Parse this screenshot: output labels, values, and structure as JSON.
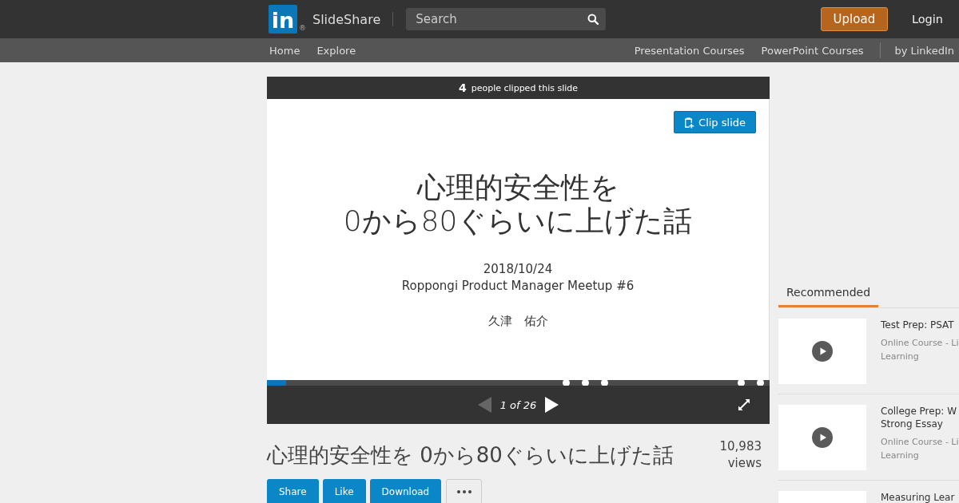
{
  "header": {
    "logo": {
      "mark": "in",
      "registered": "®",
      "name": "SlideShare"
    },
    "search": {
      "placeholder": "Search"
    },
    "upload_button": "Upload",
    "login": "Login"
  },
  "subnav": {
    "left": [
      "Home",
      "Explore"
    ],
    "right": [
      "Presentation Courses",
      "PowerPoint Courses"
    ],
    "brand": "by LinkedIn"
  },
  "player": {
    "clip_count": "4",
    "clip_text": "people clipped this slide",
    "clip_button": "Clip slide",
    "slide": {
      "title_lines": [
        "心理的安全性を",
        "0から80ぐらいに上げた話"
      ],
      "date": "2018/10/24",
      "event": "Roppongi Product Manager Meetup #6",
      "author": "久津　佑介"
    },
    "progress": {
      "level": 0.038
    },
    "prev": {
      "disabled": true
    },
    "next": {
      "disabled": false
    },
    "page": "1 of 26"
  },
  "presentation": {
    "title": "心理的安全性を 0から80ぐらいに上げた話",
    "views": "10,983",
    "views_label": "views",
    "actions": [
      "Share",
      "Like",
      "Download"
    ]
  },
  "sidebar": {
    "tabs": [
      {
        "label": "Recommended",
        "selected": true
      }
    ],
    "items": [
      {
        "title_lines": [
          "Test Prep: PSAT"
        ],
        "subtitle_lines": [
          "Online Course - Li",
          "Learning"
        ]
      },
      {
        "title_lines": [
          "College Prep: W",
          "Strong Essay"
        ],
        "subtitle_lines": [
          "Online Course - Li",
          "Learning"
        ]
      },
      {
        "title_lines": [
          "Measuring Lear"
        ]
      }
    ]
  }
}
